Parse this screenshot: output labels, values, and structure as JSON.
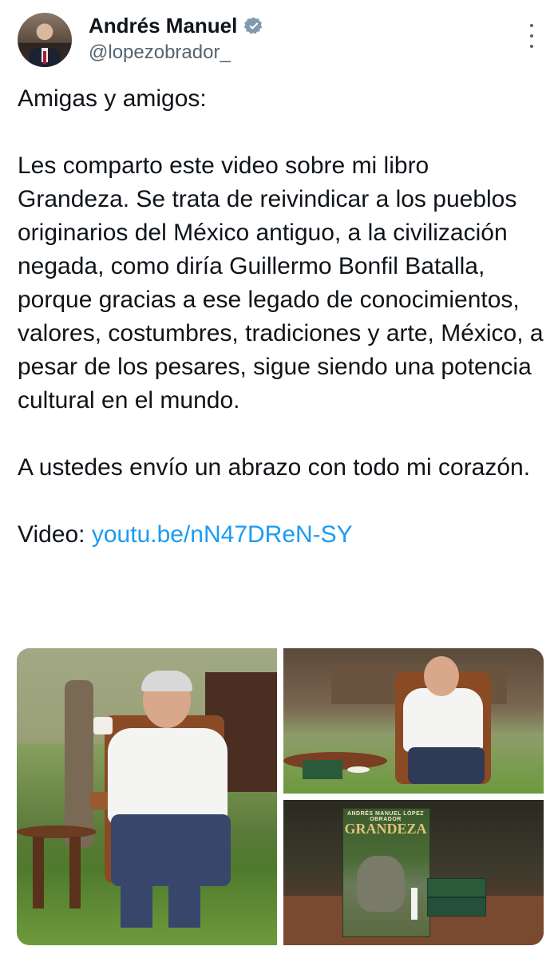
{
  "author": {
    "display_name": "Andrés Manuel",
    "handle": "@lopezobrador_",
    "verified_badge_icon": "verified-badge-icon",
    "avatar_icon": "avatar"
  },
  "menu": {
    "icon": "more-vertical-icon"
  },
  "tweet": {
    "paragraphs": [
      "Amigas y amigos:",
      "Les comparto este video sobre mi libro Grandeza. Se trata de reivindicar a los pueblos originarios del México antiguo, a la civilización negada, como diría Guillermo Bonfil Batalla, porque gracias a ese legado de conocimientos, valores, costumbres, tradiciones y arte, México, a pesar de los pesares, sigue siendo una potencia cultural en el mundo.",
      "A ustedes envío un abrazo con todo mi corazón."
    ],
    "video_label": "Video: ",
    "video_link": "youtu.be/nN47DReN-SY"
  },
  "media": {
    "book_cover": {
      "author_line": "ANDRÉS MANUEL LÓPEZ OBRADOR",
      "title": "GRANDEZA"
    }
  },
  "colors": {
    "link": "#1d9bf0",
    "verified": "#829aab",
    "secondary_text": "#536471",
    "primary_text": "#0f1419"
  }
}
